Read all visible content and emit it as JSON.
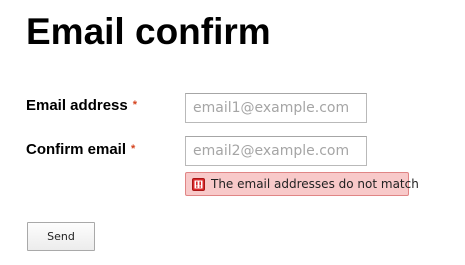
{
  "page": {
    "title": "Email confirm"
  },
  "form": {
    "email": {
      "label": "Email address",
      "required_marker": "*",
      "placeholder": "email1@example.com",
      "value": ""
    },
    "confirm_email": {
      "label": "Confirm email",
      "required_marker": "*",
      "placeholder": "email2@example.com",
      "value": ""
    },
    "error": {
      "icon": "exclamation-icon",
      "message": "The email addresses do not match"
    },
    "send_label": "Send"
  },
  "colors": {
    "required": "#d5441f",
    "error_background": "#f8c9c9",
    "error_border": "#e08585",
    "error_icon": "#d9272a"
  }
}
